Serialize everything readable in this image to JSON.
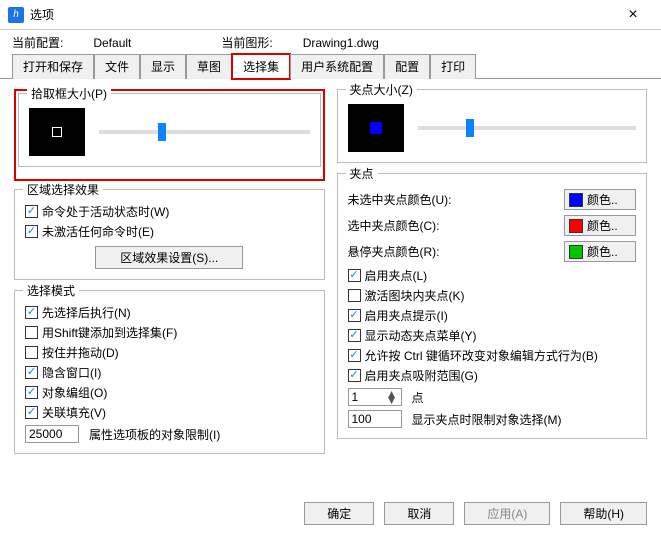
{
  "window": {
    "title": "选项",
    "icon_text": "h"
  },
  "toprow": {
    "cur_config_label": "当前配置:",
    "cur_config_value": "Default",
    "cur_drawing_label": "当前图形:",
    "cur_drawing_value": "Drawing1.dwg"
  },
  "tabs": {
    "open_save": "打开和保存",
    "file": "文件",
    "display": "显示",
    "draft": "草图",
    "select": "选择集",
    "user_sys": "用户系统配置",
    "config": "配置",
    "print": "打印"
  },
  "left": {
    "pick_size_label": "拾取框大小(P)",
    "region_title": "区域选择效果",
    "region_active": "命令处于活动状态时(W)",
    "region_inactive": "未激活任何命令时(E)",
    "region_settings_btn": "区域效果设置(S)...",
    "mode_title": "选择模式",
    "mode_pre": "先选择后执行(N)",
    "mode_shift": "用Shift键添加到选择集(F)",
    "mode_drag": "按住并拖动(D)",
    "mode_implied": "隐含窗口(I)",
    "mode_objgrp": "对象编组(O)",
    "mode_assoc": "关联填充(V)",
    "mode_limit_value": "25000",
    "mode_limit_label": "属性选项板的对象限制(I)"
  },
  "right": {
    "grip_size_label": "夹点大小(Z)",
    "grip_title": "夹点",
    "unsel_label": "未选中夹点颜色(U):",
    "sel_label": "选中夹点颜色(C):",
    "hover_label": "悬停夹点颜色(R):",
    "color_btn": "颜色..",
    "enable_grip": "启用夹点(L)",
    "enable_block": "激活图块内夹点(K)",
    "enable_tip": "启用夹点提示(I)",
    "dyn_menu": "显示动态夹点菜单(Y)",
    "ctrl_cycle": "允许按 Ctrl 键循环改变对象编辑方式行为(B)",
    "grip_range": "启用夹点吸附范围(G)",
    "grip_range_value": "1",
    "grip_range_unit": "点",
    "grip_limit_value": "100",
    "grip_limit_label": "显示夹点时限制对象选择(M)"
  },
  "colors": {
    "unsel": "#0000ff",
    "sel": "#ff0000",
    "hover": "#00c800"
  },
  "footer": {
    "ok": "确定",
    "cancel": "取消",
    "apply": "应用(A)",
    "help": "帮助(H)"
  }
}
